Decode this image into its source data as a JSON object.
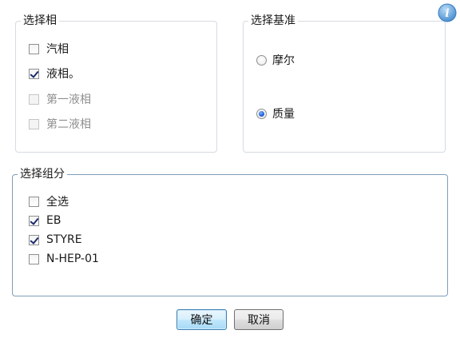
{
  "phase_group": {
    "title": "选择相",
    "options": [
      {
        "label": "汽相",
        "checked": false,
        "enabled": true
      },
      {
        "label": "液相。",
        "checked": true,
        "enabled": true
      },
      {
        "label": "第一液相",
        "checked": false,
        "enabled": false
      },
      {
        "label": "第二液相",
        "checked": false,
        "enabled": false
      }
    ]
  },
  "basis_group": {
    "title": "选择基准",
    "options": [
      {
        "label": "摩尔",
        "selected": false
      },
      {
        "label": "质量",
        "selected": true
      }
    ]
  },
  "component_group": {
    "title": "选择组分",
    "options": [
      {
        "label": "全选",
        "checked": false
      },
      {
        "label": "EB",
        "checked": true
      },
      {
        "label": "STYRE",
        "checked": true
      },
      {
        "label": "N-HEP-01",
        "checked": false
      }
    ]
  },
  "buttons": {
    "ok_label": "确定",
    "cancel_label": "取消"
  },
  "info": {
    "icon": "info-icon",
    "glyph": "i"
  }
}
